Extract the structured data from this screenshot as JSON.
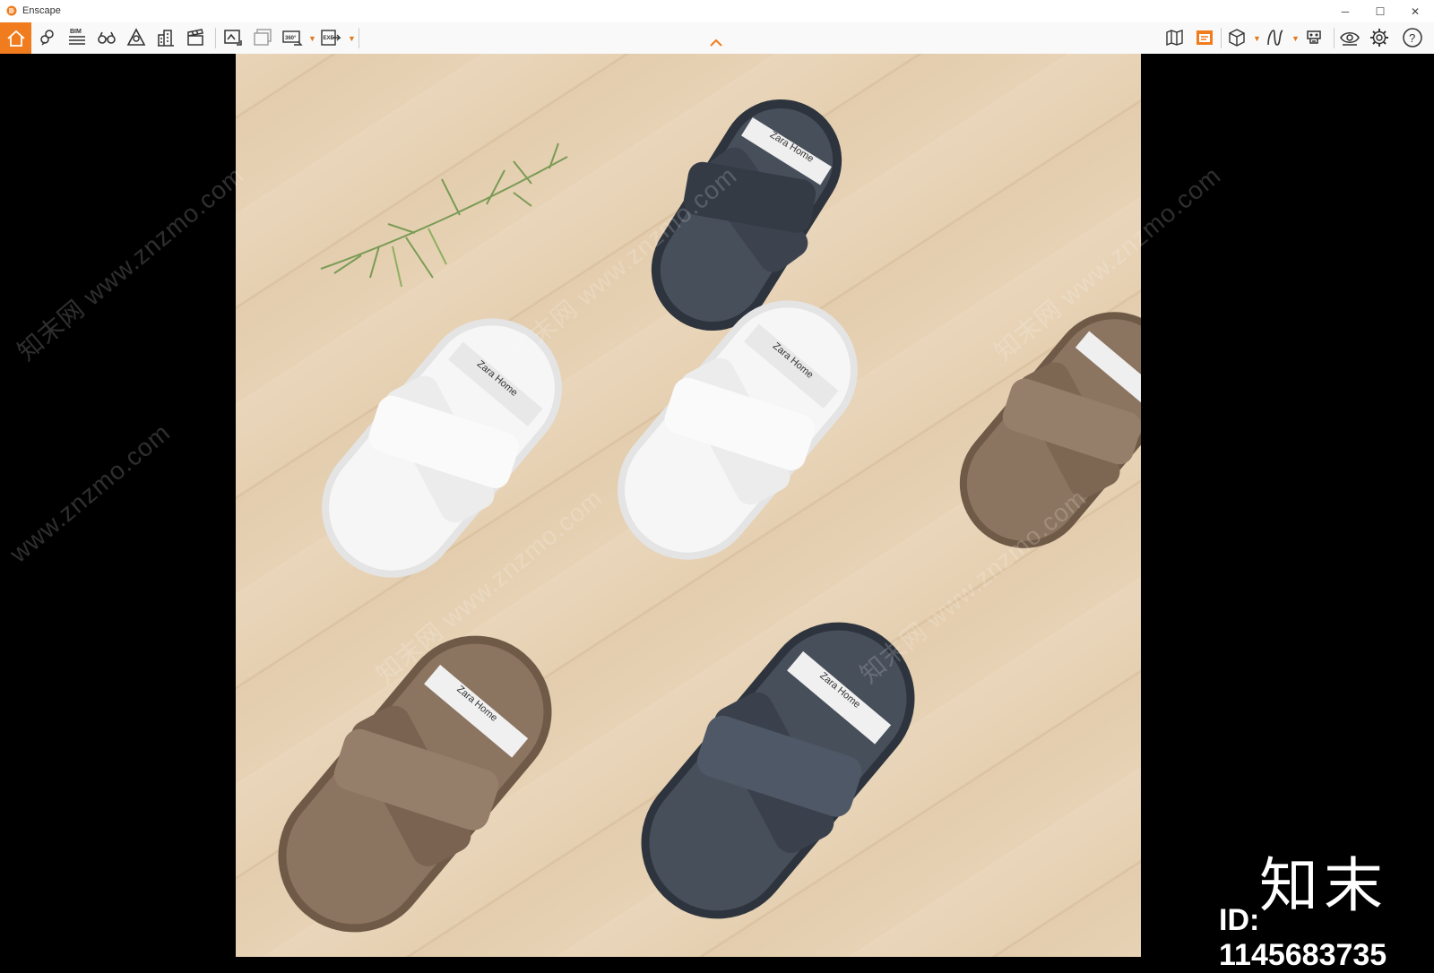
{
  "window": {
    "title": "Enscape",
    "minimize_glyph": "─",
    "maximize_glyph": "☐",
    "close_glyph": "✕"
  },
  "toolbar": {
    "bim_label": "BIM",
    "left_tools": [
      "home-icon",
      "location-icon",
      "bim-list-icon",
      "binoculars-icon",
      "warning-triangle-icon",
      "building-icon",
      "clapper-icon",
      "screenshot-icon",
      "batch-render-icon",
      "panorama-360-icon",
      "export-exe-icon"
    ],
    "right_tools": [
      "map-icon",
      "render-window-icon",
      "cube-icon",
      "path-icon",
      "vr-headset-icon",
      "eye-icon",
      "gear-icon",
      "help-icon"
    ],
    "pano_label": "360°",
    "exe_label": "EXE",
    "help_glyph": "?"
  },
  "scene": {
    "slipper_brand": "Zara Home"
  },
  "watermarks": [
    "知末网 www.znzmo.com",
    "www.znzmo.com"
  ],
  "corner_logo": {
    "text": "知末",
    "id_text": "ID: 1145683735"
  },
  "colors": {
    "accent": "#f07c1e",
    "floor": "#e6d0b2",
    "navy": "#3b4350",
    "brown": "#86705c",
    "white": "#f3f3f3"
  }
}
